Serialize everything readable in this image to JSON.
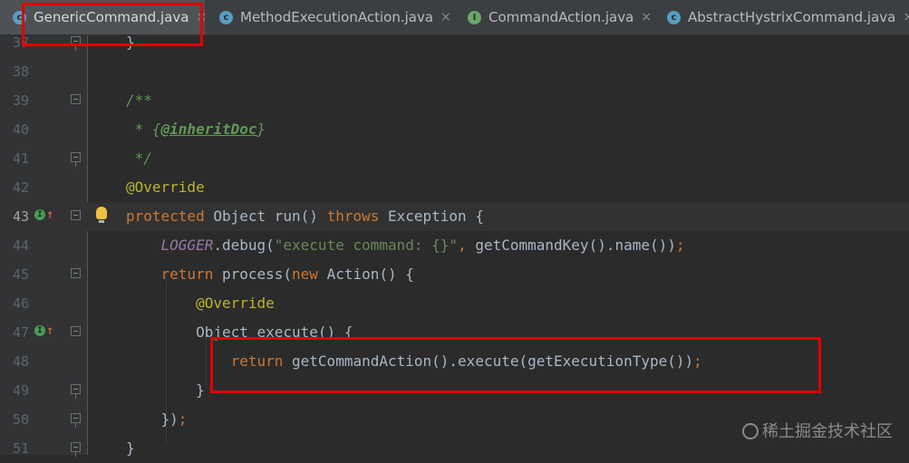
{
  "tabs": [
    {
      "label": "GenericCommand.java",
      "icon": "class-icon",
      "icon_letter": "c",
      "active": true
    },
    {
      "label": "MethodExecutionAction.java",
      "icon": "class-icon",
      "icon_letter": "c",
      "active": false
    },
    {
      "label": "CommandAction.java",
      "icon": "interface-icon",
      "icon_letter": "I",
      "active": false
    },
    {
      "label": "AbstractHystrixCommand.java",
      "icon": "class-icon",
      "icon_letter": "c",
      "active": false
    }
  ],
  "close_glyph": "×",
  "editor": {
    "lines": [
      {
        "num": "37",
        "code": "}"
      },
      {
        "num": "38",
        "code": ""
      },
      {
        "num": "39",
        "code": "/**"
      },
      {
        "num": "40",
        "code": " * {@inheritDoc}"
      },
      {
        "num": "41",
        "code": " */"
      },
      {
        "num": "42",
        "code": "@Override"
      },
      {
        "num": "43",
        "code": "protected Object run() throws Exception {"
      },
      {
        "num": "44",
        "code": "    LOGGER.debug(\"execute command: {}\", getCommandKey().name());"
      },
      {
        "num": "45",
        "code": "    return process(new Action() {"
      },
      {
        "num": "46",
        "code": "        @Override"
      },
      {
        "num": "47",
        "code": "        Object execute() {"
      },
      {
        "num": "48",
        "code": "            return getCommandAction().execute(getExecutionType());"
      },
      {
        "num": "49",
        "code": "        }"
      },
      {
        "num": "50",
        "code": "    });"
      },
      {
        "num": "51",
        "code": "}"
      }
    ]
  },
  "colors": {
    "background": "#2b2b2b",
    "keyword": "#cc7832",
    "annotation": "#bbb529",
    "string": "#6a8759",
    "comment": "#629755",
    "static_field": "#9876aa",
    "highlight_box": "#e00000"
  },
  "watermark": "稀土掘金技术社区"
}
